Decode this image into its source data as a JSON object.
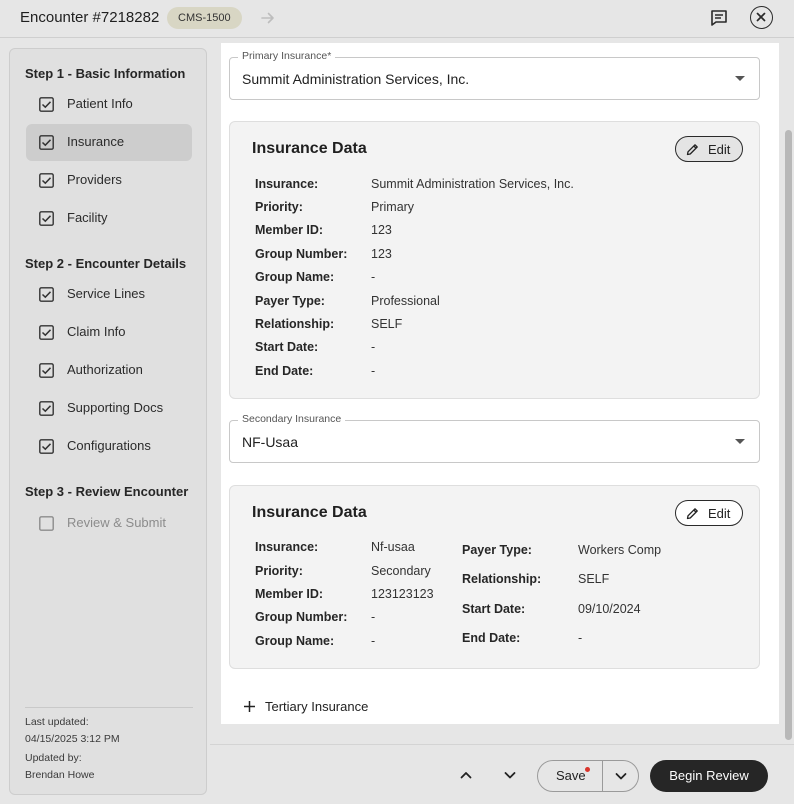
{
  "header": {
    "title": "Encounter #7218282",
    "badge": "CMS-1500"
  },
  "sidebar": {
    "steps": [
      {
        "heading": "Step 1 - Basic Information",
        "items": [
          {
            "label": "Patient Info",
            "checked": true
          },
          {
            "label": "Insurance",
            "checked": true,
            "active": true
          },
          {
            "label": "Providers",
            "checked": true
          },
          {
            "label": "Facility",
            "checked": true
          }
        ]
      },
      {
        "heading": "Step 2 - Encounter Details",
        "items": [
          {
            "label": "Service Lines",
            "checked": true
          },
          {
            "label": "Claim Info",
            "checked": true
          },
          {
            "label": "Authorization",
            "checked": true
          },
          {
            "label": "Supporting Docs",
            "checked": true
          },
          {
            "label": "Configurations",
            "checked": true
          }
        ]
      },
      {
        "heading": "Step 3 - Review Encounter",
        "items": [
          {
            "label": "Review & Submit",
            "checked": false,
            "disabled": true
          }
        ]
      }
    ],
    "meta": {
      "last_updated_label": "Last updated:",
      "last_updated_value": "04/15/2025 3:12 PM",
      "updated_by_label": "Updated by:",
      "updated_by_value": "Brendan Howe"
    }
  },
  "primary": {
    "field_label": "Primary Insurance*",
    "field_value": "Summit Administration Services, Inc.",
    "card": {
      "title": "Insurance Data",
      "edit_label": "Edit",
      "rows": [
        {
          "k": "Insurance:",
          "v": "Summit Administration Services, Inc."
        },
        {
          "k": "Priority:",
          "v": "Primary"
        },
        {
          "k": "Member ID:",
          "v": "123"
        },
        {
          "k": "Group Number:",
          "v": "123"
        },
        {
          "k": "Group Name:",
          "v": "-"
        },
        {
          "k": "Payer Type:",
          "v": "Professional"
        },
        {
          "k": "Relationship:",
          "v": "SELF"
        },
        {
          "k": "Start Date:",
          "v": "-"
        },
        {
          "k": "End Date:",
          "v": "-"
        }
      ]
    }
  },
  "secondary": {
    "field_label": "Secondary Insurance",
    "field_value": "NF-Usaa",
    "card": {
      "title": "Insurance Data",
      "edit_label": "Edit",
      "left_rows": [
        {
          "k": "Insurance:",
          "v": "Nf-usaa"
        },
        {
          "k": "Priority:",
          "v": "Secondary"
        },
        {
          "k": "Member ID:",
          "v": "123123123"
        },
        {
          "k": "Group Number:",
          "v": "-"
        },
        {
          "k": "Group Name:",
          "v": "-"
        }
      ],
      "right_rows": [
        {
          "k": "Payer Type:",
          "v": "Workers Comp"
        },
        {
          "k": "Relationship:",
          "v": "SELF"
        },
        {
          "k": "Start Date:",
          "v": "09/10/2024"
        },
        {
          "k": "End Date:",
          "v": "-"
        }
      ]
    }
  },
  "tertiary": {
    "label": "Tertiary Insurance"
  },
  "footer": {
    "save_label": "Save",
    "begin_review_label": "Begin Review"
  },
  "icons": {
    "header_arrow": "arrow-right-icon",
    "header_comment": "comment-icon",
    "header_close": "close-icon",
    "checkbox_checked": "checkbox-checked-icon",
    "checkbox_empty": "checkbox-empty-icon",
    "caret": "caret-down-icon",
    "edit": "pencil-icon",
    "add": "plus-icon",
    "nav_up": "chevron-up-icon",
    "nav_down": "chevron-down-icon"
  },
  "colors": {
    "accent_dark": "#262626",
    "active_item_bg": "#cdcdcd",
    "badge_bg": "#d8d6c4",
    "unsaved_dot": "#d9342b"
  }
}
